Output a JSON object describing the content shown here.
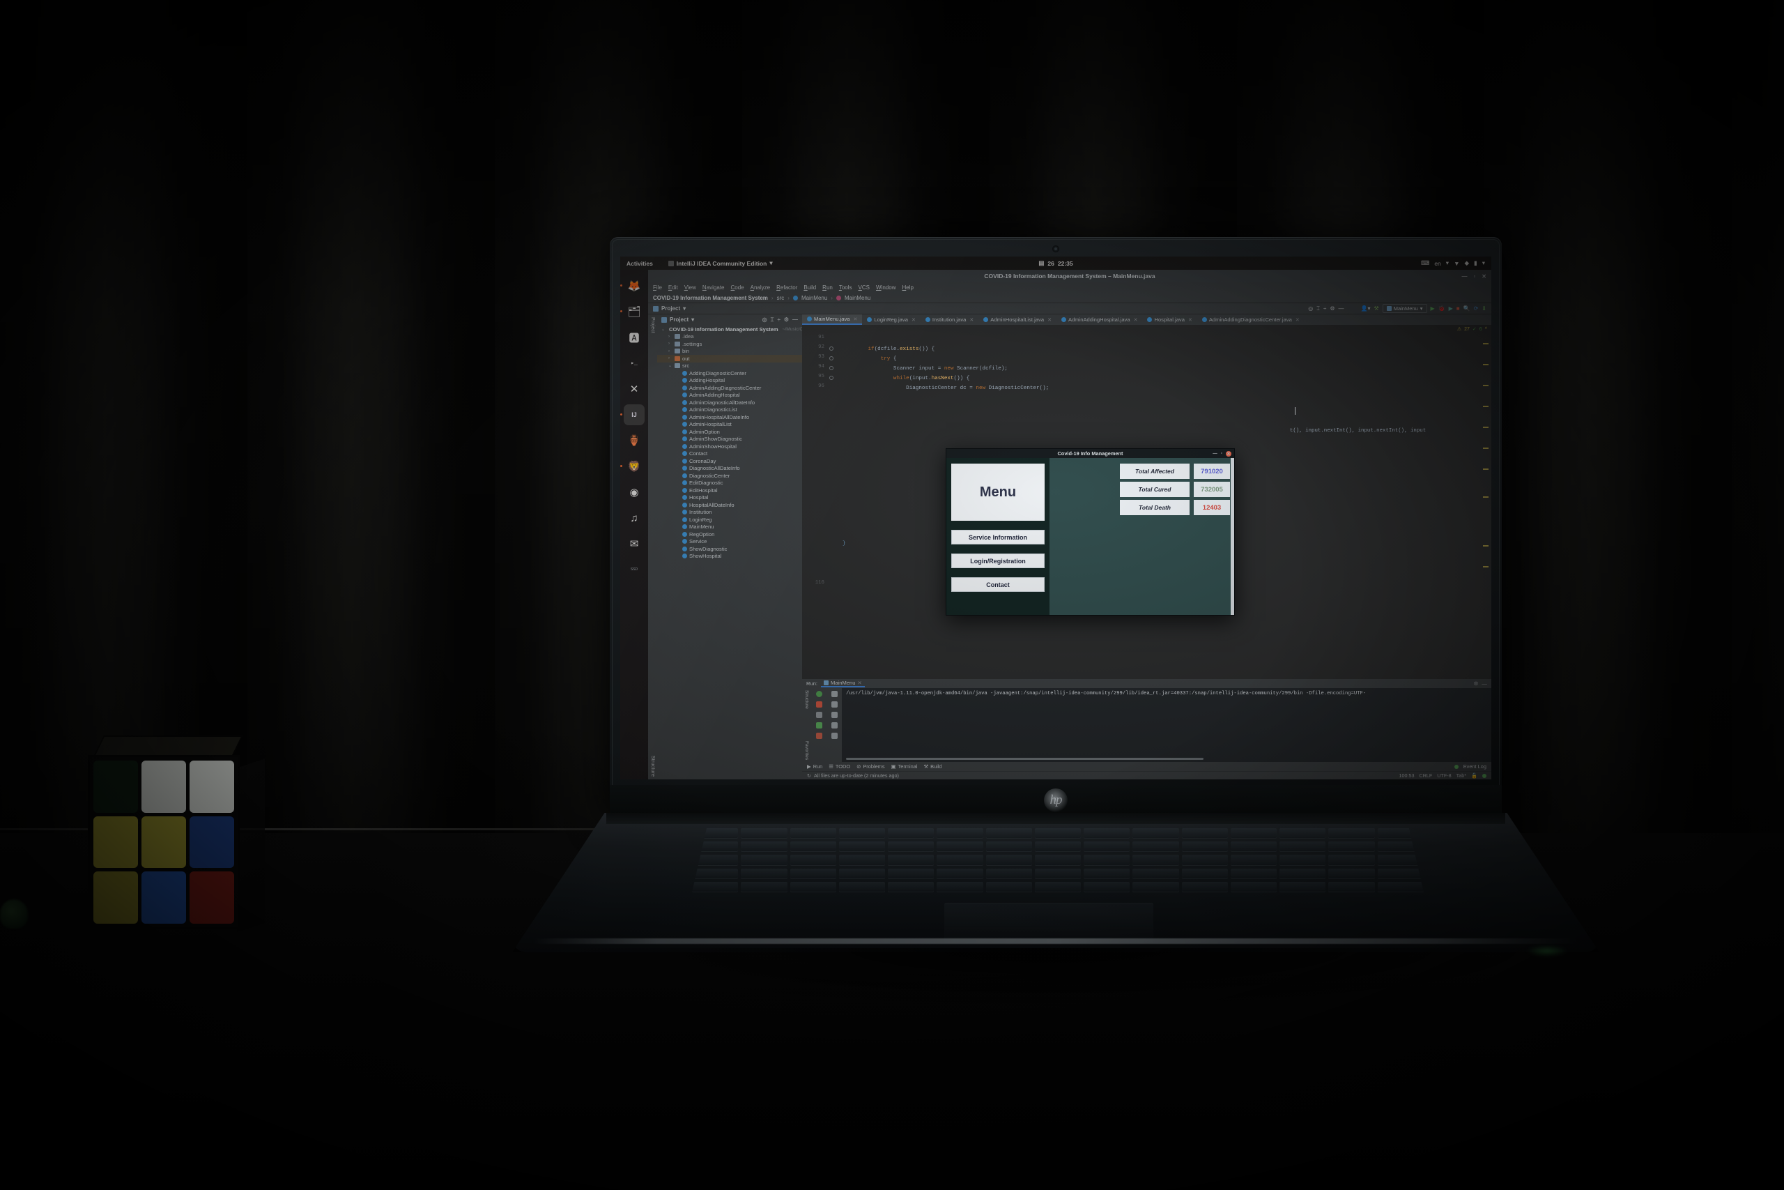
{
  "desktop": {
    "topbar": {
      "activities": "Activities",
      "app_name": "IntelliJ IDEA Community Edition",
      "app_caret": "▾",
      "clock_date": "26",
      "clock_time": "22:35",
      "keyboard_layout": "en",
      "layout_caret": "▾",
      "system_caret": "▾"
    },
    "dock": [
      {
        "name": "firefox",
        "glyph": "🦊",
        "running": true
      },
      {
        "name": "files",
        "glyph": "🗂",
        "running": true
      },
      {
        "name": "ubuntu-software",
        "glyph": "🅰",
        "running": false
      },
      {
        "name": "terminal",
        "glyph": "▸_",
        "running": false
      },
      {
        "name": "vscode",
        "glyph": "✕",
        "running": false
      },
      {
        "name": "intellij-idea",
        "glyph": "IJ",
        "running": true
      },
      {
        "name": "postman",
        "glyph": "🏺",
        "running": false
      },
      {
        "name": "brave",
        "glyph": "🦁",
        "running": true
      },
      {
        "name": "obs-studio",
        "glyph": "◉",
        "running": false
      },
      {
        "name": "spotify",
        "glyph": "♫",
        "running": false
      },
      {
        "name": "thunderbird",
        "glyph": "✉",
        "running": false
      },
      {
        "name": "ssd-drive",
        "glyph": "SSD",
        "running": false
      }
    ]
  },
  "ide": {
    "window_title": "COVID-19 Information Management System – MainMenu.java",
    "window_buttons": {
      "minimize": "—",
      "maximize": "▫",
      "close": "✕"
    },
    "menu": [
      "File",
      "Edit",
      "View",
      "Navigate",
      "Code",
      "Analyze",
      "Refactor",
      "Build",
      "Run",
      "Tools",
      "VCS",
      "Window",
      "Help"
    ],
    "breadcrumb": {
      "project": "COVID-19 Information Management System",
      "src": "src",
      "package": "MainMenu",
      "class": "MainMenu"
    },
    "toolbar": {
      "run_config": "MainMenu",
      "run_config_caret": "▾",
      "project_label": "Project",
      "project_caret": "▾"
    },
    "project_panel": {
      "title": "Project",
      "root": {
        "name": "COVID-19 Information Management System",
        "path": "~/Music/COV"
      },
      "folders": [
        {
          "name": ".idea",
          "kind": "folder"
        },
        {
          "name": ".settings",
          "kind": "folder"
        },
        {
          "name": "bin",
          "kind": "folder"
        },
        {
          "name": "out",
          "kind": "folder-out",
          "selected": true
        },
        {
          "name": "src",
          "kind": "folder-open"
        }
      ],
      "classes": [
        "AddingDiagnosticCenter",
        "AddingHospital",
        "AdminAddingDiagnosticCenter",
        "AdminAddingHospital",
        "AdminDiagnosticAllDateInfo",
        "AdminDiagnosticList",
        "AdminHospitalAllDateInfo",
        "AdminHospitalList",
        "AdminOption",
        "AdminShowDiagnostic",
        "AdminShowHospital",
        "Contact",
        "CoronaDay",
        "DiagnosticAllDateInfo",
        "DiagnosticCenter",
        "EditDiagnostic",
        "EditHospital",
        "Hospital",
        "HospitalAllDateInfo",
        "Institution",
        "LoginReg",
        "MainMenu",
        "RegOption",
        "Service",
        "ShowDiagnostic",
        "ShowHospital"
      ]
    },
    "rail": {
      "top": "Project",
      "structure": "Structure",
      "favorites": "Favorites"
    },
    "tabs": [
      {
        "label": "MainMenu.java",
        "active": true
      },
      {
        "label": "LoginReg.java",
        "active": false
      },
      {
        "label": "Institution.java",
        "active": false
      },
      {
        "label": "AdminHospitalList.java",
        "active": false
      },
      {
        "label": "AdminAddingHospital.java",
        "active": false
      },
      {
        "label": "Hospital.java",
        "active": false
      },
      {
        "label": "AdminAddingDiagnosticCenter.java",
        "active": false
      }
    ],
    "inspections": {
      "warnings": "27",
      "checks": "6"
    },
    "code": {
      "line_numbers": [
        "91",
        "92",
        "93",
        "94",
        "95",
        "96"
      ],
      "lines": [
        "",
        "        if(dcfile.exists()) {",
        "            try {",
        "                Scanner input = new Scanner(dcfile);",
        "                while(input.hasNext()) {",
        "                    DiagnosticCenter dc = new DiagnosticCenter();"
      ],
      "tail_line_number": "116",
      "tail_line": "    }",
      "right_fragment": "t(), input.nextInt(), input.nextInt(), input"
    },
    "run": {
      "label": "Run:",
      "config_name": "MainMenu",
      "command": "/usr/lib/jvm/java-1.11.0-openjdk-amd64/bin/java -javaagent:/snap/intellij-idea-community/299/lib/idea_rt.jar=40337:/snap/intellij-idea-community/299/bin -Dfile.encoding=UTF-"
    },
    "status": {
      "tabs": [
        "Run",
        "TODO",
        "Problems",
        "Terminal",
        "Build"
      ],
      "message": "All files are up-to-date (2 minutes ago)",
      "caret_position": "100:53",
      "line_separator": "CRLF",
      "encoding": "UTF-8",
      "indent": "Tab*",
      "event_log": "Event Log"
    }
  },
  "dialog": {
    "title": "Covid-19 Info Management",
    "buttons": {
      "minimize": "—",
      "maximize": "▫",
      "close": "✕"
    },
    "menu_heading": "Menu",
    "nav_buttons": [
      "Service Information",
      "Login/Registration",
      "Contact"
    ],
    "stats": [
      {
        "label": "Total Affected",
        "value": "791020",
        "color": "#5b5fd6"
      },
      {
        "label": "Total Cured",
        "value": "732005",
        "color": "#7f9c82"
      },
      {
        "label": "Total Death",
        "value": "12403",
        "color": "#d9493f"
      }
    ]
  },
  "hardware": {
    "laptop_brand": "hp"
  },
  "cube": {
    "face_colors": [
      "#0d1b10",
      "#c9cdc8",
      "#d4d8d3",
      "#8a8428",
      "#938d2c",
      "#1b3a7a",
      "#7e7824",
      "#1f4a96",
      "#6e1a14"
    ],
    "top_colors": [
      "#cfd3ce",
      "#2a5a30",
      "#c05a1c"
    ]
  }
}
